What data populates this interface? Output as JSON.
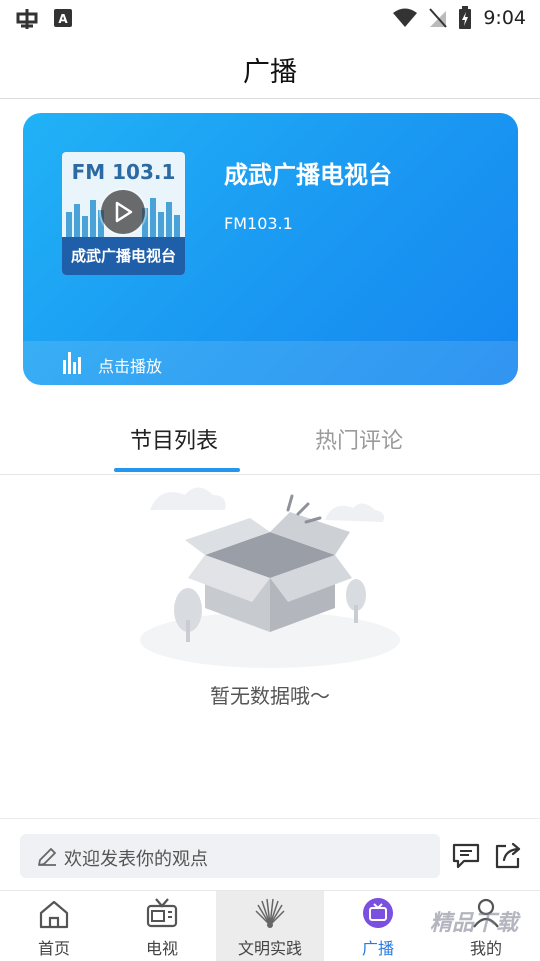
{
  "status_bar": {
    "time": "9:04",
    "app_icon_1": "bug-icon",
    "app_icon_2": "a-notification-icon"
  },
  "header": {
    "title": "广播"
  },
  "station": {
    "name": "成武广播电视台",
    "frequency": "FM103.1",
    "cover_fm_text": "FM 103.1",
    "cover_label": "成武广播电视台",
    "play_label": "点击播放"
  },
  "tabs": [
    {
      "label": "节目列表",
      "active": true
    },
    {
      "label": "热门评论",
      "active": false
    }
  ],
  "empty_state": {
    "message": "暂无数据哦～"
  },
  "comment_bar": {
    "placeholder": "欢迎发表你的观点"
  },
  "bottom_nav": [
    {
      "label": "首页",
      "icon": "home-icon"
    },
    {
      "label": "电视",
      "icon": "tv-icon"
    },
    {
      "label": "文明实践",
      "icon": "peacock-logo-icon"
    },
    {
      "label": "广播",
      "icon": "radio-tv-icon",
      "active": true
    },
    {
      "label": "我的",
      "icon": "person-icon"
    }
  ],
  "watermark": "精品下载",
  "colors": {
    "accent": "#1a98f2",
    "active_nav": "#2a7be0",
    "tab_underline": "#2496ee"
  }
}
